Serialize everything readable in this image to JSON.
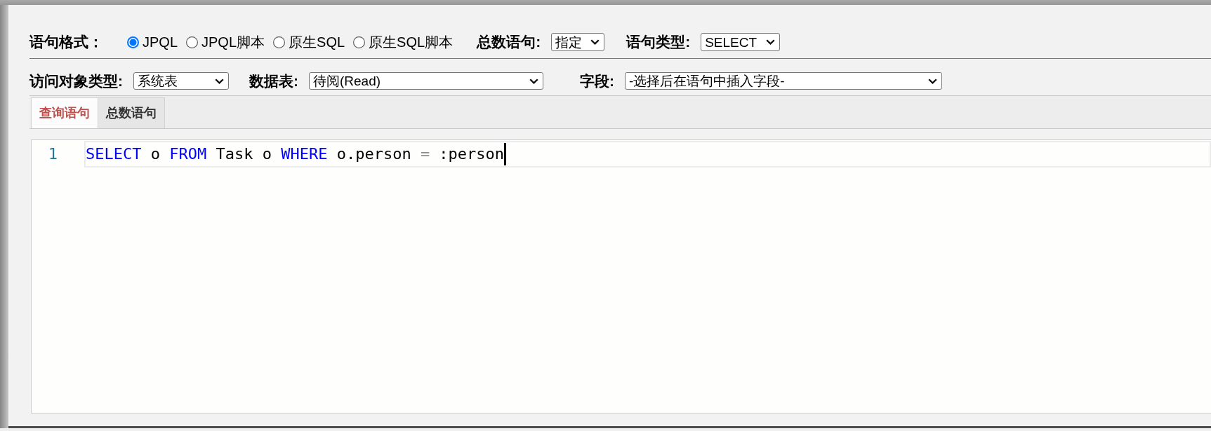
{
  "form_rows": [
    {
      "items": [
        {
          "kind": "radio_group",
          "label": "语句格式：",
          "options": [
            {
              "label": "JPQL",
              "selected": true
            },
            {
              "label": "JPQL脚本",
              "selected": false
            },
            {
              "label": "原生SQL",
              "selected": false
            },
            {
              "label": "原生SQL脚本",
              "selected": false
            }
          ]
        },
        {
          "kind": "select",
          "label": "总数语句:",
          "value": "指定"
        },
        {
          "kind": "select",
          "label": "语句类型:",
          "value": "SELECT"
        }
      ]
    },
    {
      "items": [
        {
          "kind": "select",
          "label": "访问对象类型:",
          "value": "系统表"
        },
        {
          "kind": "select",
          "label": "数据表:",
          "value": "待阅(Read)"
        },
        {
          "kind": "select",
          "label": "字段:",
          "value": "-选择后在语句中插入字段-"
        }
      ]
    }
  ],
  "tabs": [
    {
      "label": "查询语句",
      "selected": true
    },
    {
      "label": "总数语句",
      "selected": false
    }
  ],
  "editor": {
    "lines": [
      {
        "number": "1",
        "cursor": true,
        "tokens": [
          {
            "text": "SELECT",
            "kind": "keyword"
          },
          {
            "text": " o ",
            "kind": "plain"
          },
          {
            "text": "FROM",
            "kind": "keyword"
          },
          {
            "text": " Task o ",
            "kind": "plain"
          },
          {
            "text": "WHERE",
            "kind": "keyword"
          },
          {
            "text": " o.person ",
            "kind": "plain"
          },
          {
            "text": "=",
            "kind": "operator"
          },
          {
            "text": " :person",
            "kind": "plain"
          }
        ]
      }
    ]
  }
}
